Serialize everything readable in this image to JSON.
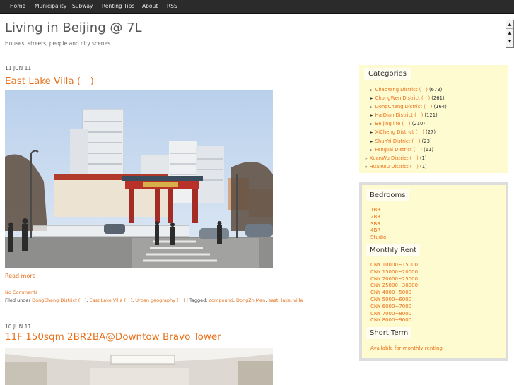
{
  "nav": {
    "items": [
      "Home",
      "Municipality",
      "Subway",
      "Renting Tips",
      "About",
      "RSS"
    ]
  },
  "site": {
    "title": "Living in Beijing @ 7L",
    "description": "Houses, streets, people and city scenes"
  },
  "scroll_widget": {
    "up_icon": "▲",
    "mid_icon": "▲",
    "down_icon": "▼"
  },
  "posts": [
    {
      "date": "11 JUN 11",
      "title": "East Lake Villa (　)",
      "read_more": "Read more",
      "comments": "No Comments",
      "filed_prefix": "Filed under ",
      "categories": [
        "DongCheng District (　)",
        "East Lake Villa (　)",
        "Urban geography (　)"
      ],
      "tagged_prefix": " | Tagged: ",
      "tags": [
        "compound",
        "DongZhiMen",
        "east",
        "lake",
        "villa"
      ]
    },
    {
      "date": "10 JUN 11",
      "title": "11F 150sqm 2BR2BA@Downtow Bravo Tower"
    }
  ],
  "sidebar": {
    "categories": {
      "heading": "Categories",
      "items": [
        {
          "bullet": "►",
          "name": "ChaoYang District (　)",
          "count": "(673)"
        },
        {
          "bullet": "►",
          "name": "ChongWen District (　)",
          "count": "(261)"
        },
        {
          "bullet": "►",
          "name": "DongCheng District (　)",
          "count": "(164)"
        },
        {
          "bullet": "►",
          "name": "HaiDian District (　)",
          "count": "(121)"
        },
        {
          "bullet": "►",
          "name": "Beijing life (　)",
          "count": "(210)"
        },
        {
          "bullet": "►",
          "name": "XiCheng District (　)",
          "count": "(27)"
        },
        {
          "bullet": "►",
          "name": "ShunYi District (　)",
          "count": "(23)"
        },
        {
          "bullet": "►",
          "name": "FengTai District (　)",
          "count": "(11)"
        },
        {
          "bullet": "»",
          "name": "XuanWu District (　)",
          "count": "(1)"
        },
        {
          "bullet": "»",
          "name": "HuaiRou District (　)",
          "count": "(1)"
        }
      ]
    },
    "bedrooms": {
      "heading": "Bedrooms",
      "items": [
        "1BR",
        "2BR",
        "3BR",
        "4BR",
        "Studio"
      ]
    },
    "rent": {
      "heading": "Monthly Rent",
      "items": [
        "CNY 10000~15000",
        "CNY 15000~20000",
        "CNY 20000~25000",
        "CNY 25000~30000",
        "CNY 4000~5000",
        "CNY 5000~6000",
        "CNY 6000~7000",
        "CNY 7000~8000",
        "CNY 8000~9000"
      ]
    },
    "short_term": {
      "heading": "Short Term",
      "items": [
        "Available for monthly renting"
      ]
    }
  },
  "colors": {
    "accent": "#e8701a",
    "nav_bg": "#2b2b2b",
    "sidebar_bg": "#fffbd0"
  }
}
